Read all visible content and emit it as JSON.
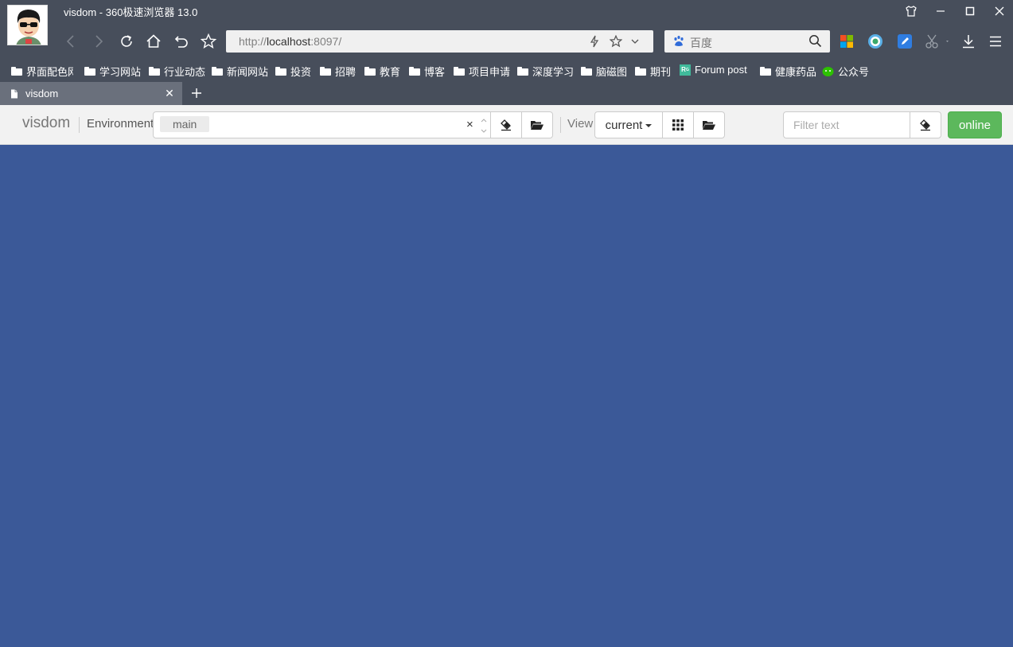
{
  "window": {
    "title": "visdom - 360极速浏览器 13.0"
  },
  "address_bar": {
    "url_prefix": "http://",
    "url_host": "localhost",
    "url_rest": ":8097/"
  },
  "search_bar": {
    "placeholder": "百度"
  },
  "bookmarks": [
    {
      "label": "界面配色网",
      "icon": "folder-icon"
    },
    {
      "label": "学习网站",
      "icon": "folder-icon"
    },
    {
      "label": "行业动态",
      "icon": "folder-icon"
    },
    {
      "label": "新闻网站",
      "icon": "folder-icon"
    },
    {
      "label": "投资",
      "icon": "folder-icon"
    },
    {
      "label": "招聘",
      "icon": "folder-icon"
    },
    {
      "label": "教育",
      "icon": "folder-icon"
    },
    {
      "label": "博客",
      "icon": "folder-icon"
    },
    {
      "label": "项目申请",
      "icon": "folder-icon"
    },
    {
      "label": "深度学习",
      "icon": "folder-icon"
    },
    {
      "label": "脑磁图",
      "icon": "folder-icon"
    },
    {
      "label": "期刊",
      "icon": "folder-icon"
    },
    {
      "label": "Forum post",
      "icon": "researchgate-icon"
    },
    {
      "label": "健康药品",
      "icon": "folder-icon"
    },
    {
      "label": "公众号",
      "icon": "wechat-icon"
    }
  ],
  "tabs": [
    {
      "title": "visdom",
      "active": true
    }
  ],
  "visdom": {
    "brand": "visdom",
    "environment_label": "Environment",
    "environment_selected": "main",
    "view_label": "View",
    "view_selected": "current",
    "filter_placeholder": "Filter text",
    "status": "online"
  },
  "colors": {
    "chrome": "#474e5b",
    "toolbar": "#f2f2f2",
    "content_background": "#3b5998",
    "online_green": "#5cb85c"
  }
}
